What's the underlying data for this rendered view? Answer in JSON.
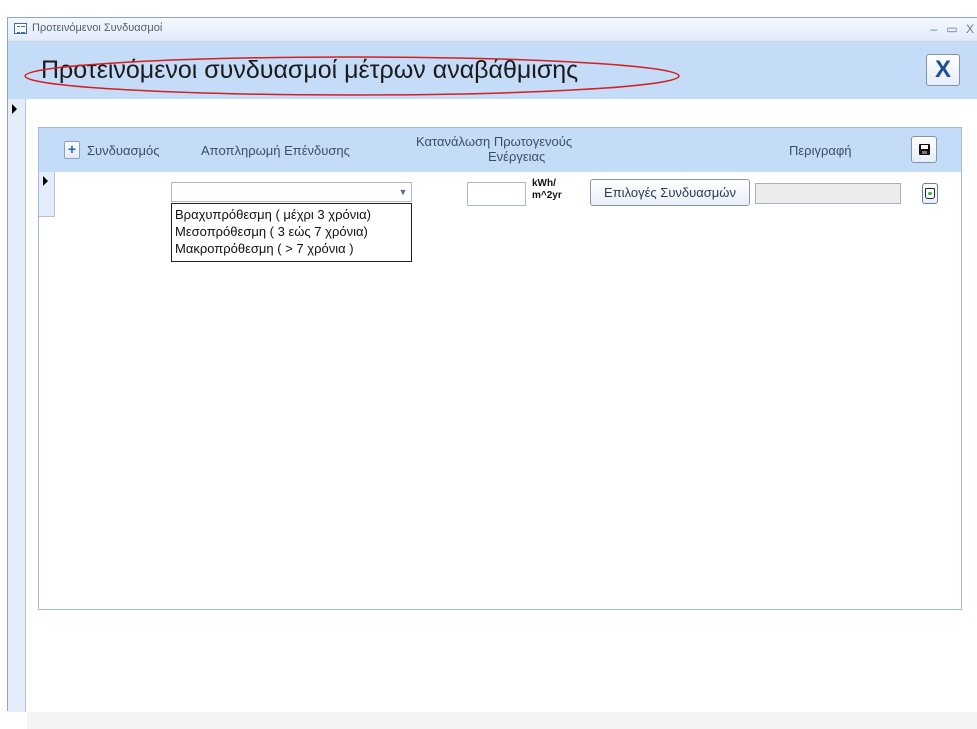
{
  "window": {
    "title": "Προτεινόμενοι Συνδυασμοί",
    "minimize_label": "–",
    "restore_label": "▭",
    "close_label": "X"
  },
  "form": {
    "title": "Προτεινόμενοι συνδυασμοί μέτρων αναβάθμισης",
    "close_label": "X",
    "annotation_color": "#d21f1f"
  },
  "subform": {
    "columns": {
      "combination": "Συνδυασμός",
      "payback": "Αποπληρωμή Επένδυσης",
      "energy_line1": "Κατανάλωση Πρωτογενούς",
      "energy_line2": "Ενέργειας",
      "description": "Περιγραφή"
    },
    "add_label": "+",
    "row": {
      "payback_value": "",
      "energy_value": "",
      "unit_line1": "kWh/",
      "unit_line2": "m^2yr",
      "options_button": "Επιλογές Συνδυασμών",
      "description_value": ""
    },
    "dropdown_options": [
      "Βραχυπρόθεσμη ( μέχρι 3 χρόνια)",
      "Μεσοπρόθεσμη ( 3 εώς 7 χρόνια)",
      "Μακροπρόθεσμη ( > 7 χρόνια )"
    ]
  },
  "colors": {
    "header_band": "#c5dcf8",
    "record_strip": "#e3ecf8"
  },
  "icons": {
    "form_icon": "form-view-icon",
    "add": "plus-icon",
    "save": "floppy-disk-icon",
    "delete": "recycle-bin-icon",
    "close": "close-x-icon",
    "dropdown": "chevron-down-icon",
    "record": "record-pointer-icon"
  }
}
